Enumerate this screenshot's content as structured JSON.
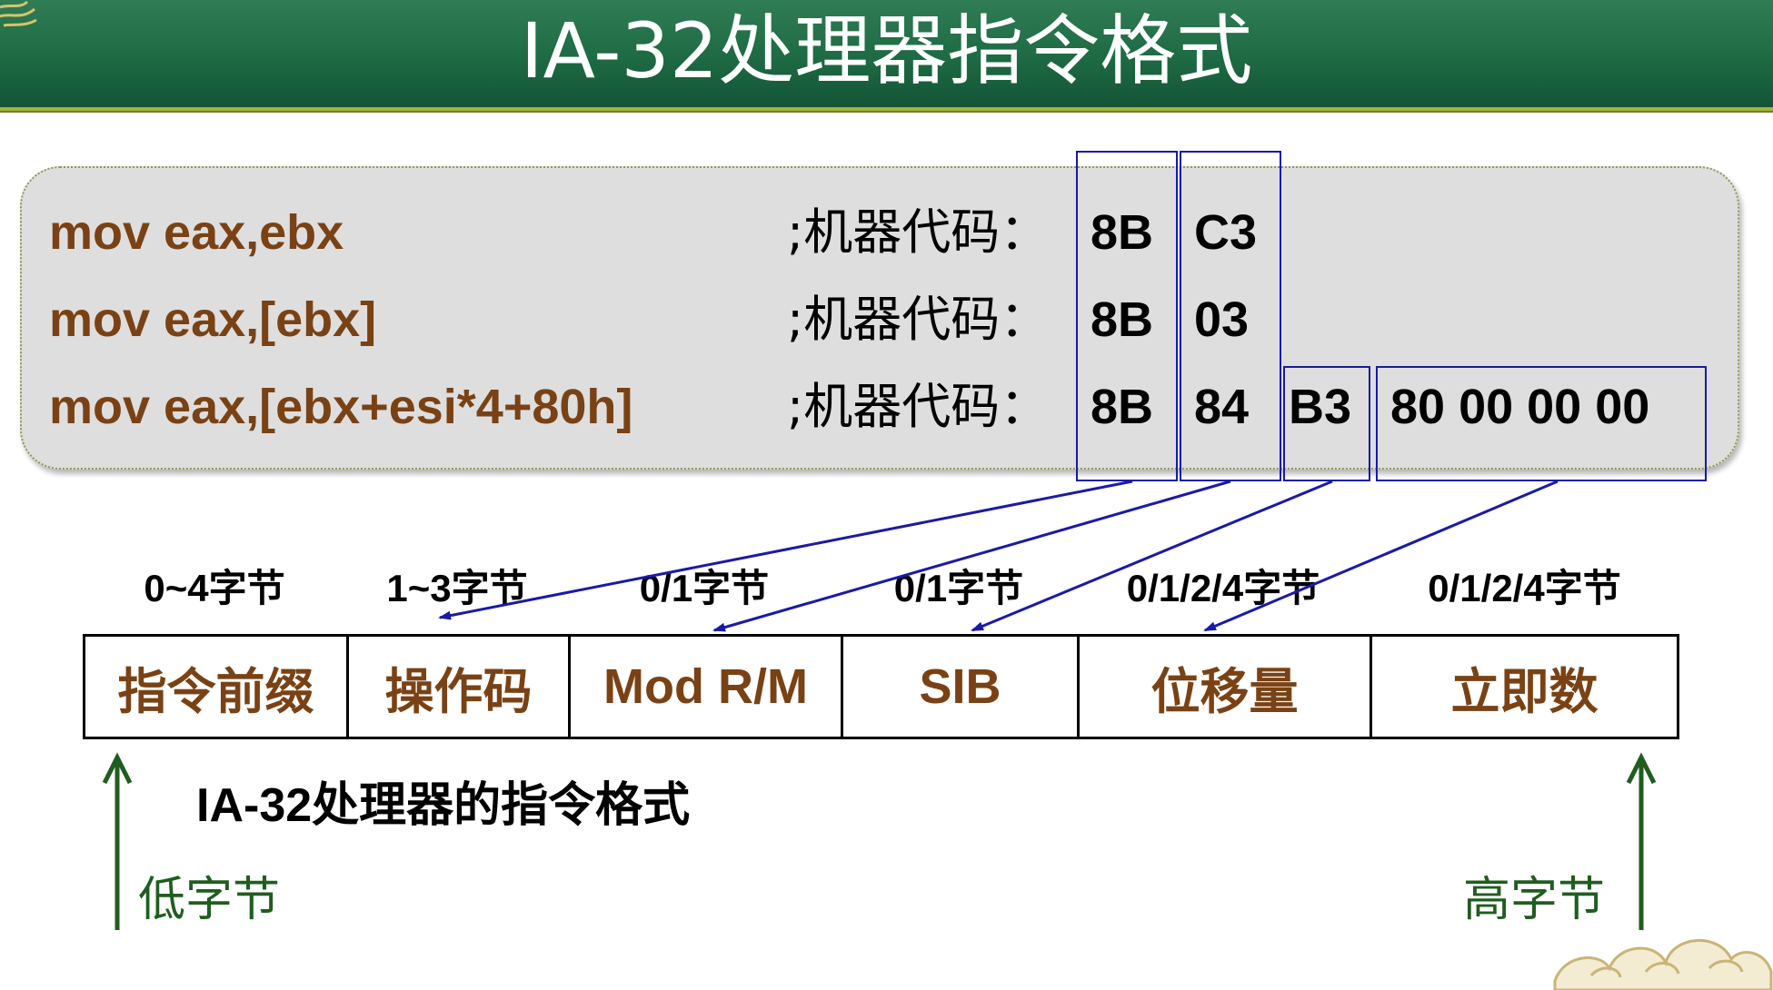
{
  "slide": {
    "title": "IA-32处理器指令格式"
  },
  "code_examples": [
    {
      "instruction": "mov eax,ebx",
      "label": ";机器代码：",
      "bytes": [
        "8B",
        "C3"
      ]
    },
    {
      "instruction": "mov eax,[ebx]",
      "label": ";机器代码：",
      "bytes": [
        "8B",
        "03"
      ]
    },
    {
      "instruction": "mov eax,[ebx+esi*4+80h]",
      "label": ";机器代码：",
      "bytes": [
        "8B",
        "84",
        "B3",
        "80 00 00 00"
      ]
    }
  ],
  "format_fields": [
    {
      "size": "0~4字节",
      "name": "指令前缀"
    },
    {
      "size": "1~3字节",
      "name": "操作码"
    },
    {
      "size": "0/1字节",
      "name": "Mod R/M"
    },
    {
      "size": "0/1字节",
      "name": "SIB"
    },
    {
      "size": "0/1/2/4字节",
      "name": "位移量"
    },
    {
      "size": "0/1/2/4字节",
      "name": "立即数"
    }
  ],
  "caption": "IA-32处理器的指令格式",
  "low_end_label": "低字节",
  "high_end_label": "高字节",
  "colors": {
    "title_bar": "#1d6a43",
    "instruction_text": "#7a4214",
    "highlight_box": "#1a1aa8",
    "end_arrow": "#1f5e1f"
  }
}
